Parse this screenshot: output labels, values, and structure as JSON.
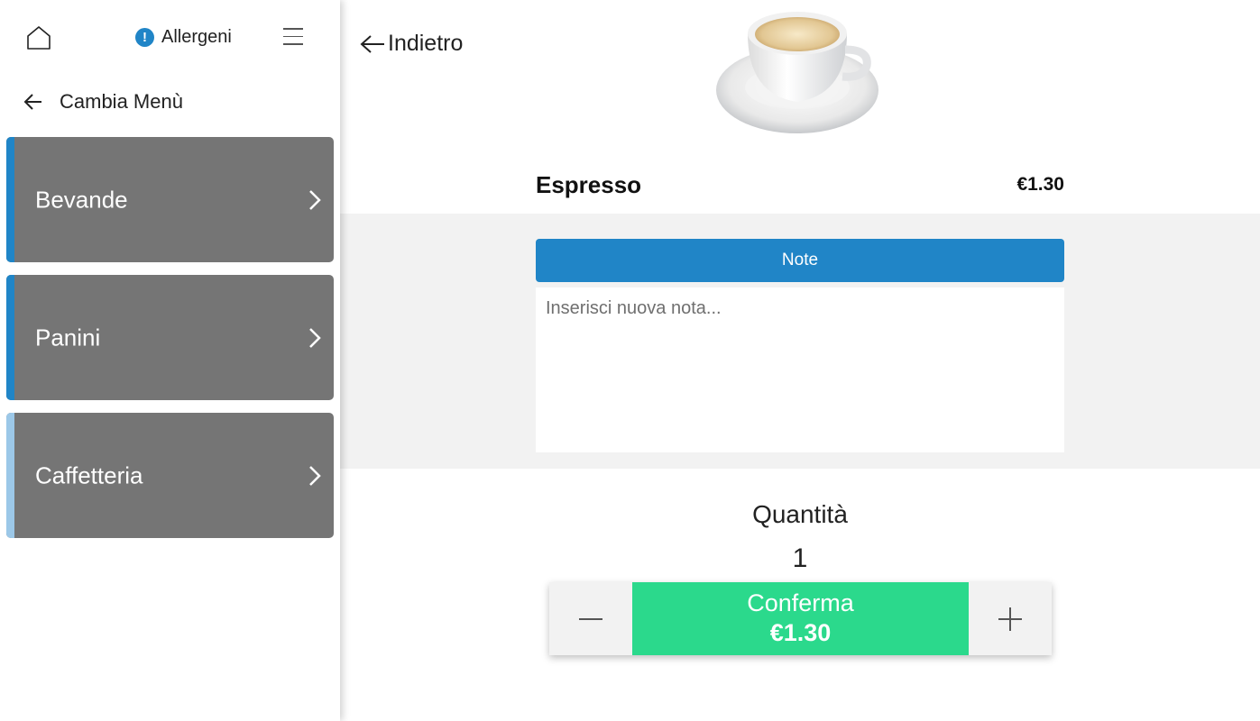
{
  "sidebar": {
    "allergeni_label": "Allergeni",
    "cambia_label": "Cambia Menù",
    "categories": [
      {
        "label": "Bevande",
        "accent": "#2085c7"
      },
      {
        "label": "Panini",
        "accent": "#2085c7"
      },
      {
        "label": "Caffetteria",
        "accent": "#9cc8e8"
      }
    ]
  },
  "main": {
    "back_label": "Indietro",
    "product": {
      "name": "Espresso",
      "price": "€1.30"
    },
    "note": {
      "button_label": "Note",
      "placeholder": "Inserisci nuova nota..."
    },
    "quantity": {
      "label": "Quantità",
      "value": "1"
    },
    "confirm": {
      "label": "Conferma",
      "price": "€1.30"
    }
  },
  "colors": {
    "accent": "#2085c7",
    "confirm": "#2bd98c",
    "card": "#757575"
  }
}
